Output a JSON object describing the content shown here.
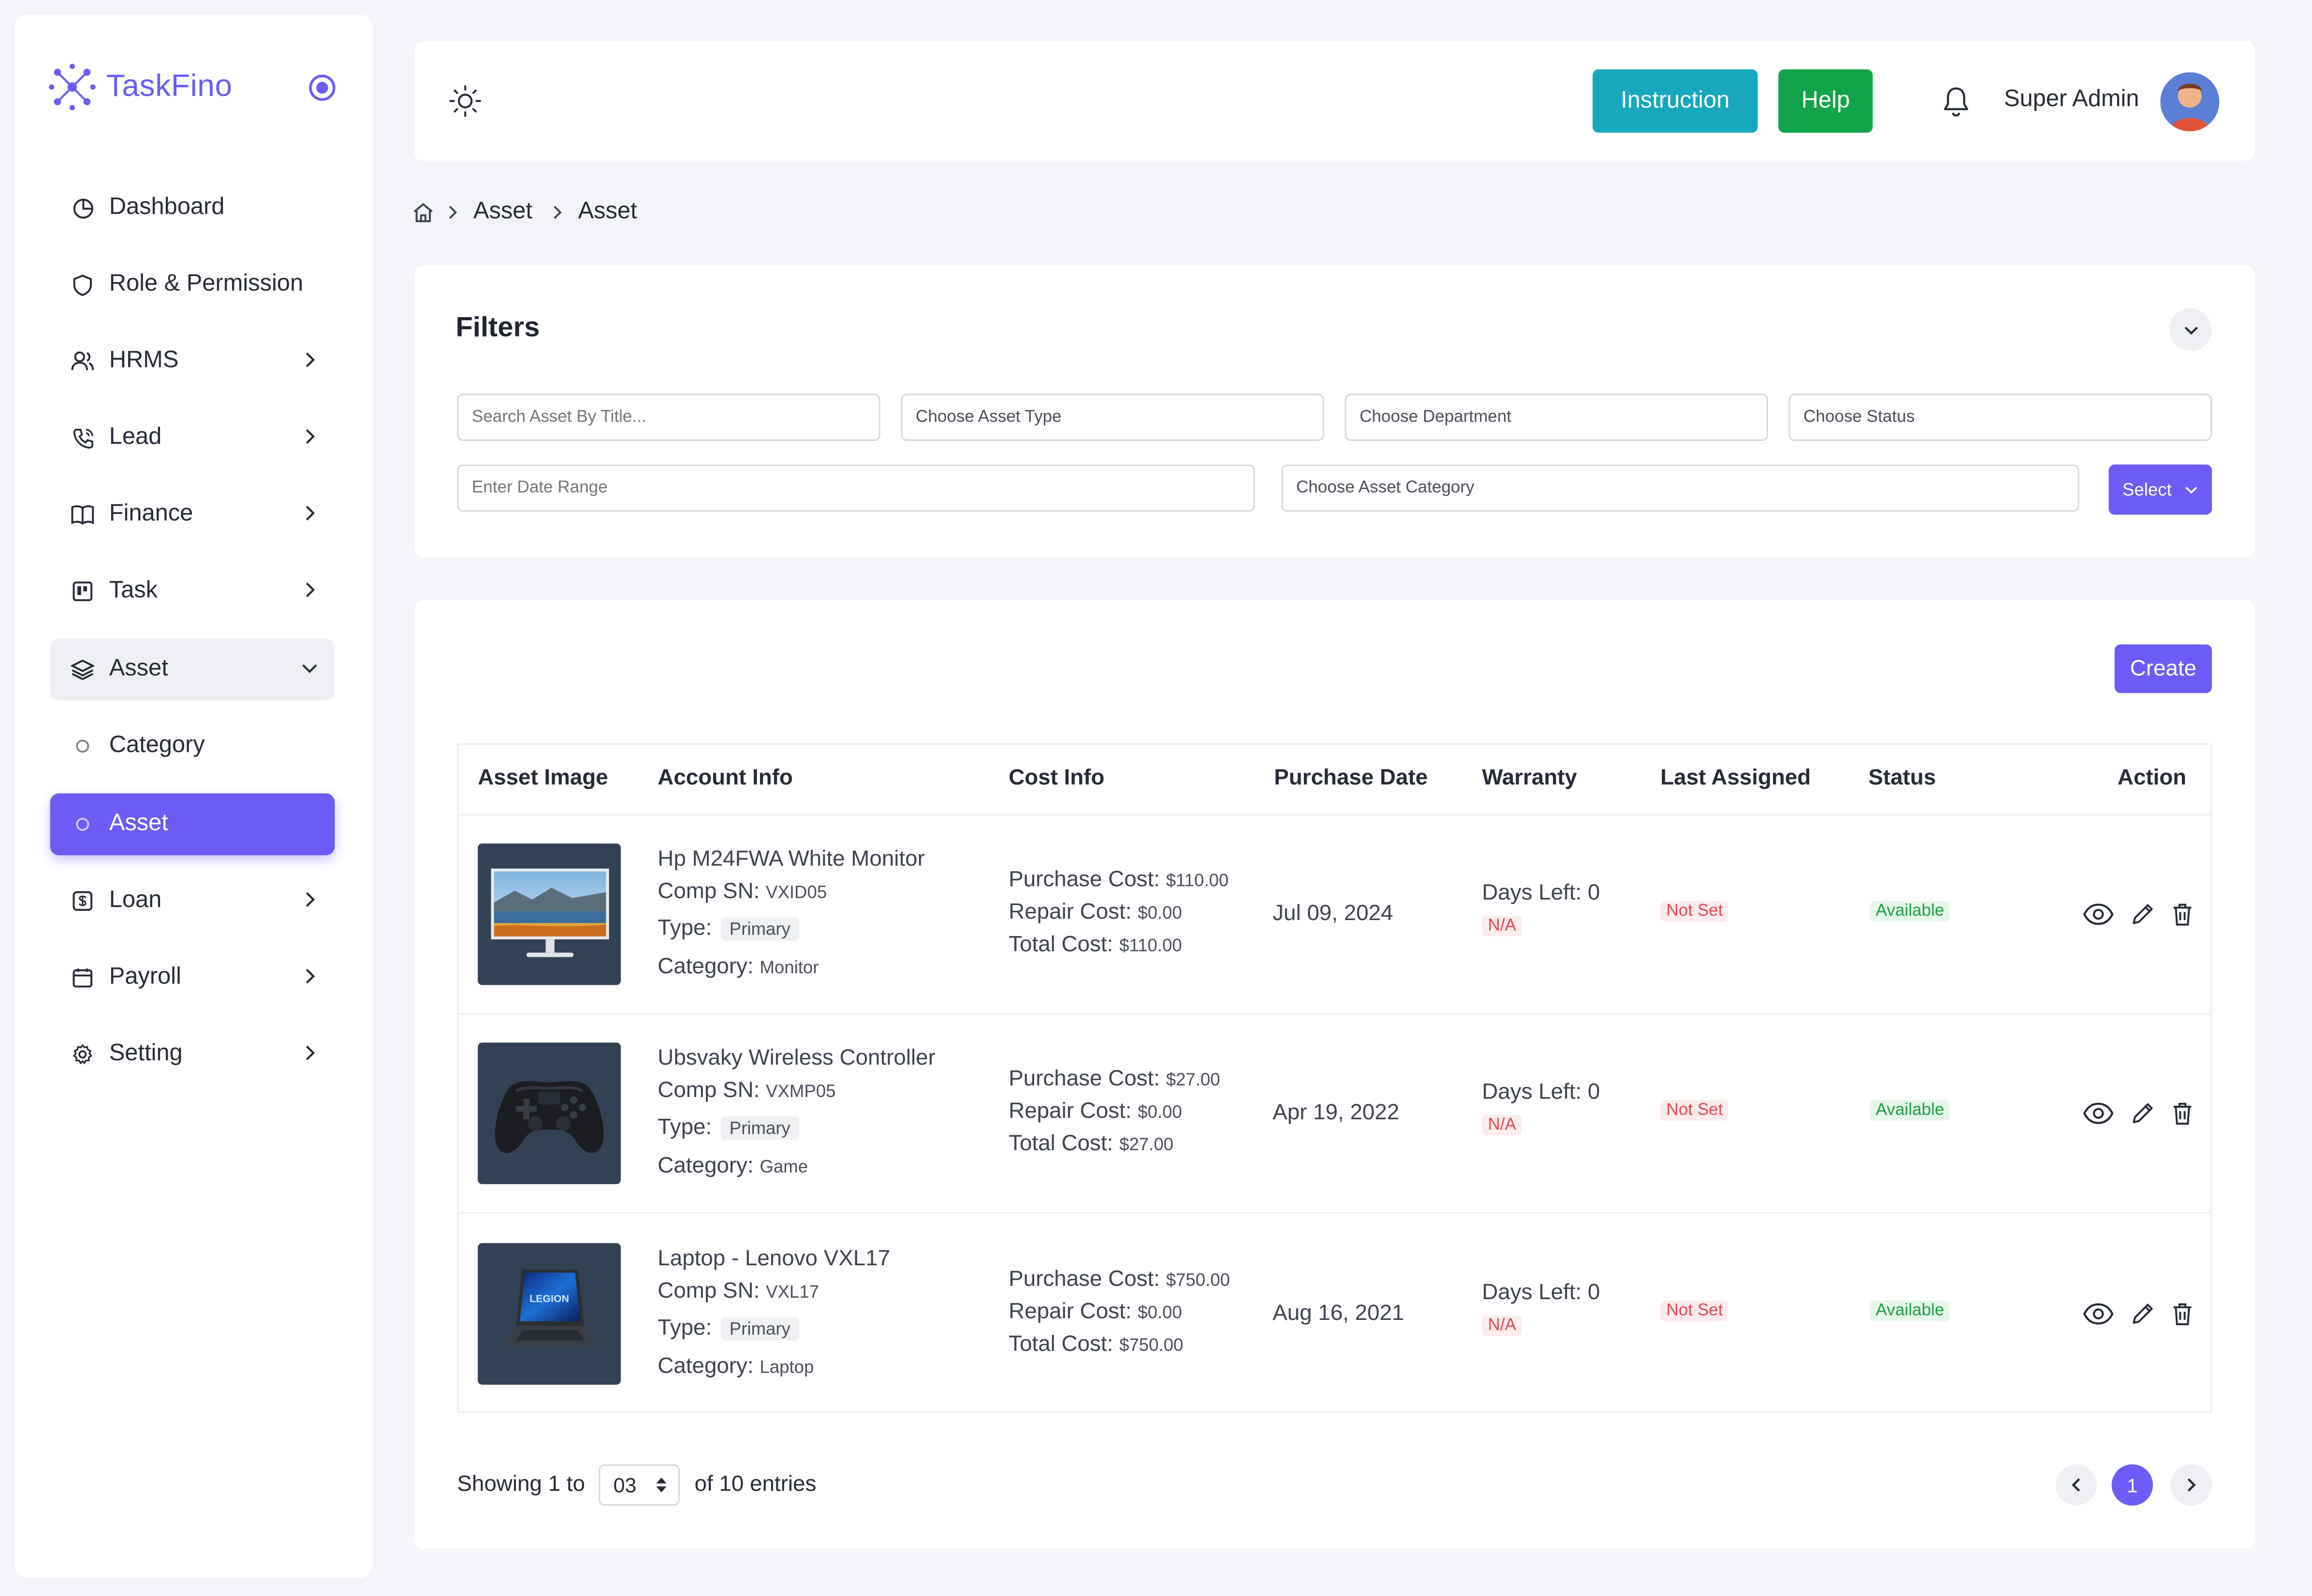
{
  "app": {
    "name": "TaskFino"
  },
  "sidebar": {
    "items": [
      {
        "label": "Dashboard",
        "icon": "pie-chart-icon"
      },
      {
        "label": "Role & Permission",
        "icon": "shield-icon"
      },
      {
        "label": "HRMS",
        "icon": "users-icon"
      },
      {
        "label": "Lead",
        "icon": "phone-icon"
      },
      {
        "label": "Finance",
        "icon": "book-icon"
      },
      {
        "label": "Task",
        "icon": "task-board-icon"
      },
      {
        "label": "Asset",
        "icon": "layers-icon"
      },
      {
        "label": "Category",
        "icon": "circle-icon"
      },
      {
        "label": "Asset",
        "icon": "circle-icon"
      },
      {
        "label": "Loan",
        "icon": "loan-icon"
      },
      {
        "label": "Payroll",
        "icon": "calendar-icon"
      },
      {
        "label": "Setting",
        "icon": "gear-icon"
      }
    ]
  },
  "header": {
    "instruction_label": "Instruction",
    "help_label": "Help",
    "user_name": "Super Admin"
  },
  "breadcrumb": {
    "items": [
      "Asset",
      "Asset"
    ]
  },
  "filters": {
    "title": "Filters",
    "search_placeholder": "Search Asset By Title...",
    "asset_type": "Choose Asset Type",
    "department": "Choose Department",
    "status": "Choose Status",
    "date_range": "Enter Date Range",
    "asset_category": "Choose Asset Category",
    "select_label": "Select"
  },
  "table": {
    "create_label": "Create",
    "headers": [
      "Asset Image",
      "Account Info",
      "Cost Info",
      "Purchase Date",
      "Warranty",
      "Last Assigned",
      "Status",
      "Action"
    ],
    "labels": {
      "comp_sn": "Comp SN:",
      "type": "Type:",
      "category": "Category:",
      "purchase_cost": "Purchase Cost:",
      "repair_cost": "Repair Cost:",
      "total_cost": "Total Cost:"
    },
    "rows": [
      {
        "name": "Hp M24FWA White Monitor",
        "sn": "VXID05",
        "type": "Primary",
        "category": "Monitor",
        "purchase": "$110.00",
        "repair": "$0.00",
        "total": "$110.00",
        "date": "Jul 09, 2024",
        "days_left": "Days Left: 0",
        "warranty_status": "N/A",
        "last_assigned": "Not Set",
        "status": "Available"
      },
      {
        "name": "Ubsvaky Wireless Controller",
        "sn": "VXMP05",
        "type": "Primary",
        "category": "Game",
        "purchase": "$27.00",
        "repair": "$0.00",
        "total": "$27.00",
        "date": "Apr 19, 2022",
        "days_left": "Days Left: 0",
        "warranty_status": "N/A",
        "last_assigned": "Not Set",
        "status": "Available"
      },
      {
        "name": "Laptop - Lenovo VXL17",
        "sn": "VXL17",
        "type": "Primary",
        "category": "Laptop",
        "purchase": "$750.00",
        "repair": "$0.00",
        "total": "$750.00",
        "date": "Aug 16, 2021",
        "days_left": "Days Left: 0",
        "warranty_status": "N/A",
        "last_assigned": "Not Set",
        "status": "Available"
      }
    ]
  },
  "pagination": {
    "showing_prefix": "Showing 1 to",
    "per_page": "03",
    "entries_suffix": "of 10 entries",
    "current_page": "1"
  },
  "colors": {
    "accent": "#6c5cf5",
    "instruction": "#17a2b8",
    "help": "#16a34a"
  }
}
